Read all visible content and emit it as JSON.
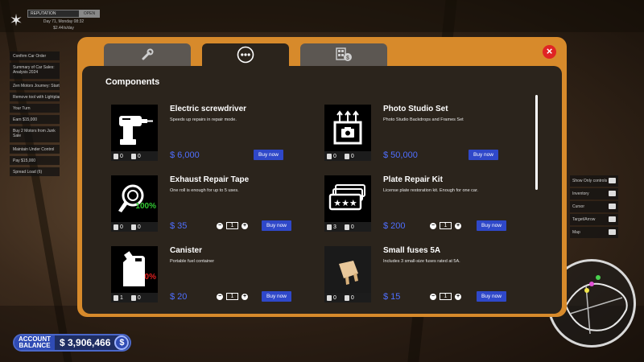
{
  "hud": {
    "reputation_label": "REPUTATION",
    "open_label": "OPEN",
    "date": "Day 71, Monday 08:32",
    "rate": "$2.44/s/day",
    "side_items": [
      "Confirm Car Order",
      "Summary of Car Sales: Analysis 2024",
      "Zen Motors Journey: Start",
      "Remove tool with Lightplanner",
      "Your Turn",
      "Earn $15,000",
      "Buy 2 Motors from Junk Sale",
      "Maintain Under Control",
      "Pay $15,000",
      "Spread Load (6)"
    ],
    "right_items": [
      "Show Only controls",
      "Inventory",
      "Cursor",
      "Target/Arrow",
      "Map"
    ]
  },
  "account": {
    "label_line1": "ACCOUNT",
    "label_line2": "BALANCE",
    "amount": "$ 3,906,466",
    "currency_icon": "$"
  },
  "shop": {
    "tabs": [
      {
        "icon": "wrench-spark-plug-icon",
        "active": false
      },
      {
        "icon": "more-dots-icon",
        "active": true
      },
      {
        "icon": "property-deals-icon",
        "active": false
      }
    ],
    "close_icon": "×",
    "section_title": "Components",
    "items": [
      {
        "name": "Electric screwdriver",
        "desc": "Speeds up repairs in repair mode.",
        "price": "$ 6,000",
        "buy": "Buy now",
        "stock_a": "0",
        "stock_b": "0",
        "icon": "screwdriver-icon"
      },
      {
        "name": "Photo Studio Set",
        "desc": "Photo Studio Backdrops and Frames Set",
        "price": "$ 50,000",
        "buy": "Buy now",
        "stock_a": "0",
        "stock_b": "0",
        "icon": "photo-studio-icon"
      },
      {
        "name": "Exhaust Repair Tape",
        "desc": "One roll is enough for up to 5 uses.",
        "price": "$ 35",
        "buy": "Buy now",
        "stock_a": "0",
        "stock_b": "0",
        "qty": "1",
        "percent": "100%",
        "percent_color": "#32c832",
        "icon": "tape-roll-icon"
      },
      {
        "name": "Plate Repair Kit",
        "desc": "License plate restoration kit. Enough for one car.",
        "price": "$ 200",
        "buy": "Buy now",
        "stock_a": "3",
        "stock_b": "0",
        "qty": "1",
        "icon": "license-plate-icon"
      },
      {
        "name": "Canister",
        "desc": "Portable fuel container",
        "price": "$ 20",
        "buy": "Buy now",
        "stock_a": "1",
        "stock_b": "0",
        "qty": "1",
        "percent": "0%",
        "percent_color": "#e02020",
        "icon": "fuel-canister-icon"
      },
      {
        "name": "Small fuses 5A",
        "desc": "Includes 3 small-size fuses rated at 5A.",
        "price": "$ 15",
        "buy": "Buy now",
        "stock_a": "0",
        "stock_b": "0",
        "qty": "1",
        "icon": "fuse-icon"
      }
    ]
  }
}
